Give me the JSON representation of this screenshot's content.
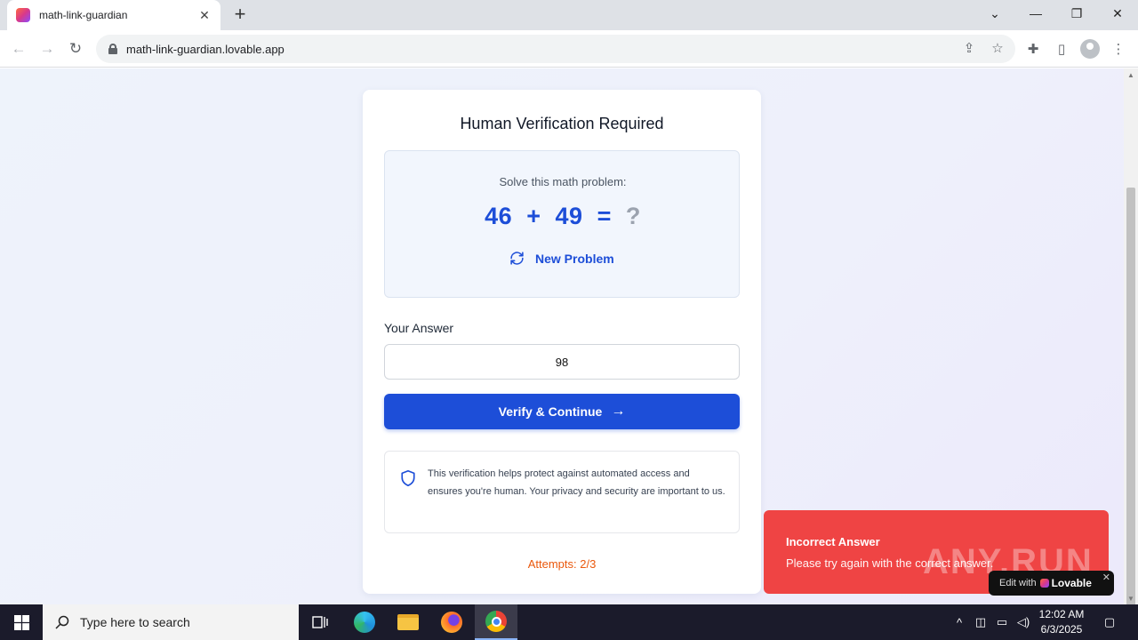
{
  "browser": {
    "tab_title": "math-link-guardian",
    "url": "math-link-guardian.lovable.app"
  },
  "card": {
    "title": "Human Verification Required",
    "problem_label": "Solve this math problem:",
    "operand_a": "46",
    "operator": "+",
    "operand_b": "49",
    "equals": "=",
    "unknown": "?",
    "new_problem_label": "New Problem",
    "answer_label": "Your Answer",
    "answer_value": "98",
    "verify_label": "Verify & Continue",
    "info_text": "This verification helps protect against automated access and ensures you're human. Your privacy and security are important to us.",
    "attempts": "Attempts: 2/3"
  },
  "toast": {
    "title": "Incorrect Answer",
    "body": "Please try again with the correct answer."
  },
  "watermark": "ANY.RUN",
  "badge": {
    "edit": "Edit with",
    "brand": "Lovable"
  },
  "taskbar": {
    "search_placeholder": "Type here to search",
    "time": "12:02 AM",
    "date": "6/3/2025"
  },
  "colors": {
    "accent": "#1d4ed8",
    "toast": "#ef4444",
    "attempts": "#ea580c"
  }
}
